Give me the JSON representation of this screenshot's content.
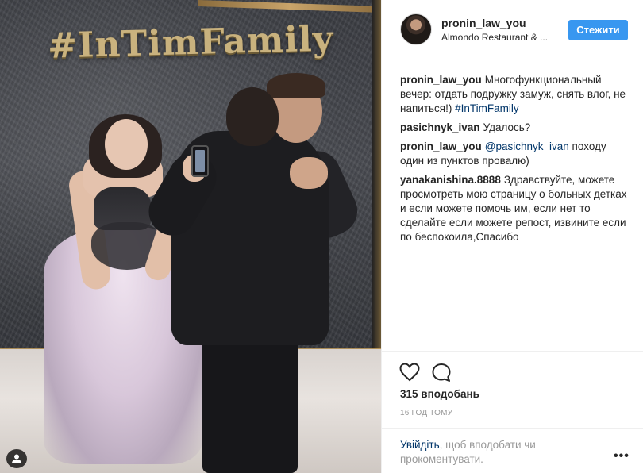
{
  "photo": {
    "sign_text": "#InTimFamily",
    "tag_icon": "user-tag-icon"
  },
  "header": {
    "username": "pronin_law_you",
    "location": "Almondo Restaurant & ...",
    "follow_label": "Стежити"
  },
  "comments": [
    {
      "author": "pronin_law_you",
      "text": "Многофункциональный вечер: отдать подружку замуж, снять влог, не напиться!) ",
      "tag": "#InTimFamily"
    },
    {
      "author": "pasichnyk_ivan",
      "text": "Удалось?",
      "tag": ""
    },
    {
      "author": "pronin_law_you",
      "tag_prefix": "@pasichnyk_ivan",
      "text": " походу один из пунктов провалю)"
    },
    {
      "author": "yanakanishina.8888",
      "text": "Здравствуйте, можете просмотреть мою страницу о больных детках и если можете помочь им, если нет то сделайте если можете репост, извините если по беспокоила,Спасибо",
      "tag": ""
    }
  ],
  "actions": {
    "like_icon": "heart-icon",
    "comment_icon": "comment-icon",
    "likes": "315 вподобань",
    "timestamp": "16 год тому"
  },
  "login": {
    "link": "Увійдіть",
    "text": ", щоб вподобати чи прокоментувати.",
    "more": "•••"
  }
}
